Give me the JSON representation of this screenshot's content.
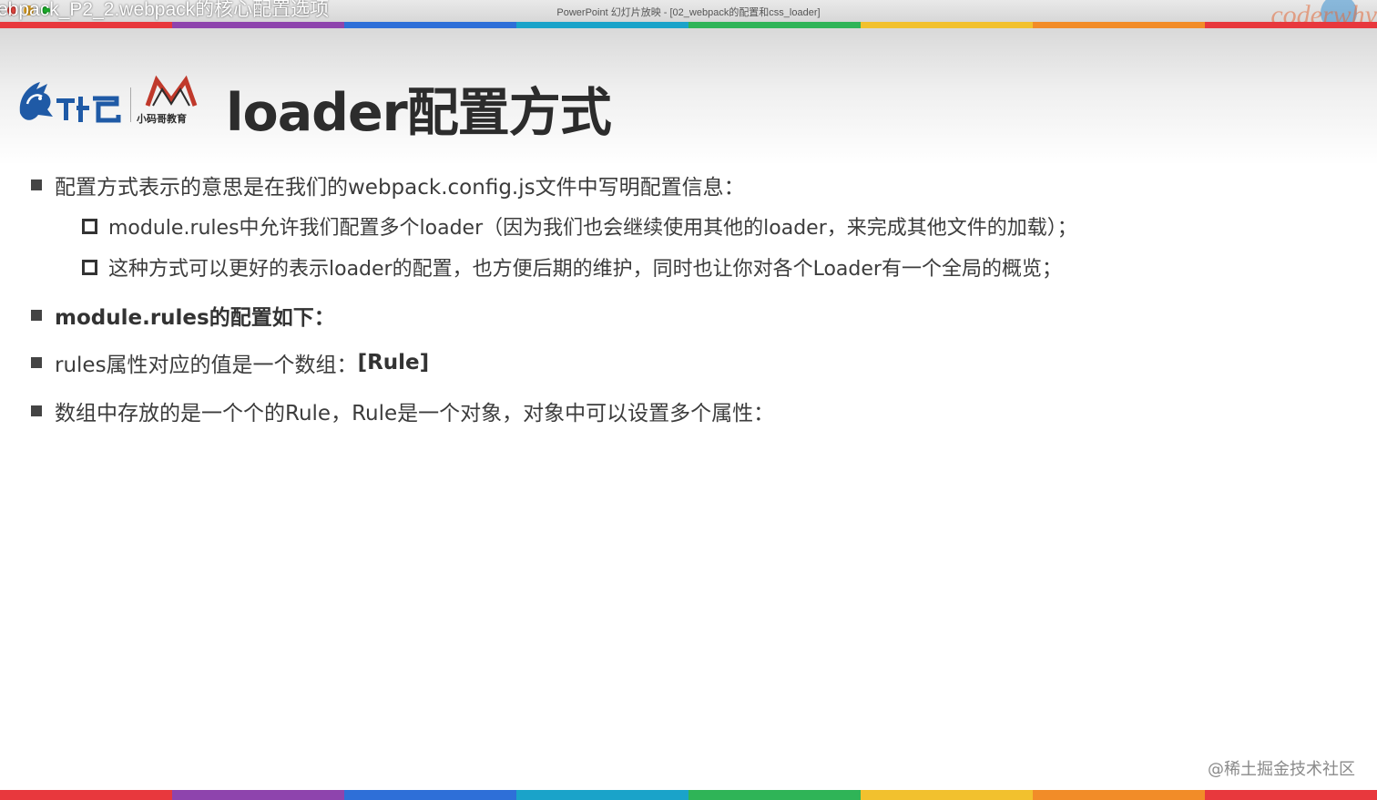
{
  "window": {
    "video_title": "ebpack_P2_2.webpack的核心配置选项",
    "app_title": "PowerPoint 幻灯片放映 - [02_webpack的配置和css_loader]",
    "brand_watermark": "coderwhy"
  },
  "stripe_colors": [
    "#e8383d",
    "#8e44ad",
    "#2e6fd8",
    "#1aa3c9",
    "#2fb457",
    "#f2c12e",
    "#f28c28",
    "#e8383d"
  ],
  "slide": {
    "title": "loader配置方式",
    "logos": {
      "logo1_icon": "wolf-logo-icon",
      "logo2_icon": "mountain-logo-icon",
      "logo2_caption": "小码哥教育"
    },
    "bullets": [
      {
        "level": 1,
        "text": "配置方式表示的意思是在我们的webpack.config.js文件中写明配置信息：",
        "bold": false
      },
      {
        "level": 2,
        "text": "module.rules中允许我们配置多个loader（因为我们也会继续使用其他的loader，来完成其他文件的加载）；",
        "bold": false
      },
      {
        "level": 2,
        "text": "这种方式可以更好的表示loader的配置，也方便后期的维护，同时也让你对各个Loader有一个全局的概览；",
        "bold": false
      },
      {
        "level": 1,
        "text": "module.rules的配置如下：",
        "bold": true
      },
      {
        "level": 1,
        "text_main": "rules属性对应的值是一个数组：",
        "text_bold": "[Rule]"
      },
      {
        "level": 1,
        "text": "数组中存放的是一个个的Rule，Rule是一个对象，对象中可以设置多个属性：",
        "bold": false
      }
    ]
  },
  "footer": {
    "watermark": "@稀土掘金技术社区"
  }
}
